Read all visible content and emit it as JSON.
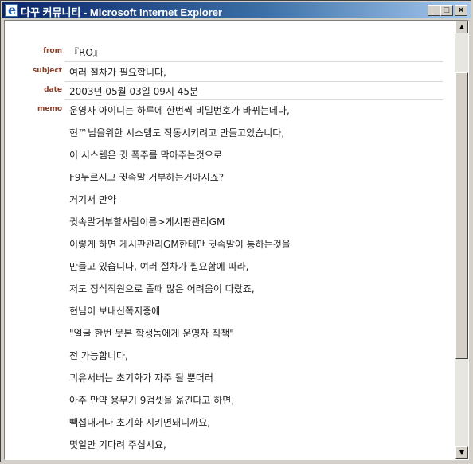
{
  "window": {
    "title": "다꾸 커뮤니티 - Microsoft Internet Explorer",
    "minimize": "_",
    "maximize": "□",
    "close": "×"
  },
  "scrollbar": {
    "up": "▲",
    "down": "▼"
  },
  "post": {
    "from_label": "from",
    "from_value": "『RO』",
    "subject_label": "subject",
    "subject_value": "여러 절차가 필요합니다,",
    "date_label": "date",
    "date_value": "2003년 05월 03일 09시 45분",
    "memo_label": "memo",
    "memo_lines": [
      "운영자 아이디는 하루에 한번씩 비밀번호가 바뀌는데다,",
      "현™님을위한 시스템도 작동시키려고 만들고있습니다,",
      "이 시스템은 귓 폭주를 막아주는것으로",
      "F9누르시고 귓속말 거부하는거아시죠?",
      "거기서 만약",
      "귓속말거부할사람이름>게시판관리GM",
      "이렇게 하면 게시판관리GM한테만 귓속말이 통하는것을",
      "만들고 있습니다, 여러 절차가 필요함에 따라,",
      "저도 정식직원으로 졸때 많은 어려움이 따랐죠,",
      "현님이 보내신쪽지중에",
      "\"얼굴 한번 못본 학생놈에게 운영자 직책\"",
      "전 가능합니다,",
      "괴유서버는 초기화가 자주 될 뿐더러",
      "아주 만약 용무기 9검셋을 옮긴다고 하면,",
      "빽섭내거나 초기화 시키면돼니까요,",
      "몇일만 기다려 주십시요,"
    ]
  }
}
